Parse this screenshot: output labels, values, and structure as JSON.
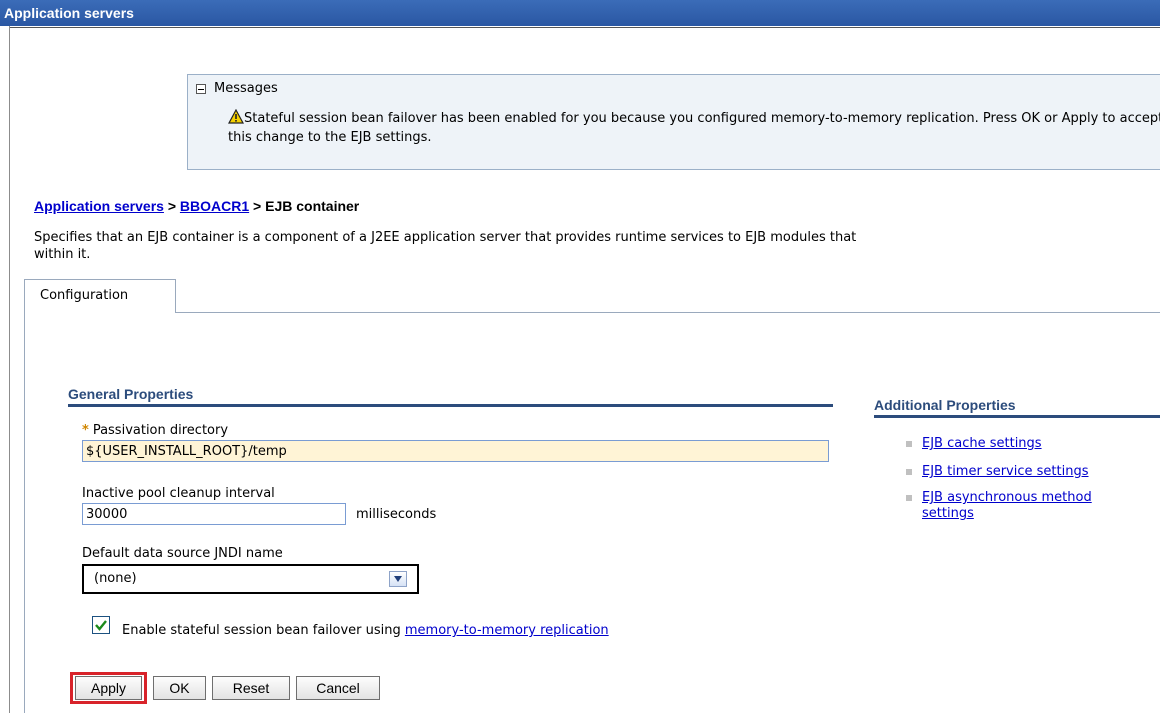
{
  "window": {
    "title": "Application servers"
  },
  "messages": {
    "header": "Messages",
    "text": "Stateful session bean failover has been enabled for you because you configured memory-to-memory replication. Press OK or Apply to accept this change to the EJB settings."
  },
  "breadcrumb": {
    "item1": "Application servers",
    "sep1": ">",
    "item2": "BBOACR1",
    "sep2": ">",
    "current": "EJB container"
  },
  "description": "Specifies that an EJB container is a component of a J2EE application server that provides runtime services to EJB modules that\nwithin it.",
  "tabs": [
    {
      "label": "Configuration",
      "selected": true
    }
  ],
  "general": {
    "title": "General Properties",
    "passivation": {
      "label": "Passivation directory",
      "value": "${USER_INSTALL_ROOT}/temp"
    },
    "cleanup": {
      "label": "Inactive pool cleanup interval",
      "value": "30000",
      "unit": "milliseconds"
    },
    "jndi": {
      "label": "Default data source JNDI name",
      "selected": "(none)"
    },
    "failover": {
      "checked": true,
      "text": "Enable stateful session bean failover using ",
      "link": "memory-to-memory replication"
    }
  },
  "additional": {
    "title": "Additional Properties",
    "items": [
      {
        "label": "EJB cache settings"
      },
      {
        "label": "EJB timer service settings"
      },
      {
        "label": "EJB asynchronous method",
        "label2": "settings"
      }
    ]
  },
  "buttons": {
    "apply": "Apply",
    "ok": "OK",
    "reset": "Reset",
    "cancel": "Cancel"
  },
  "colors": {
    "titlebar": "#2f5fad",
    "link": "#0000cc",
    "section": "#2c4c7c",
    "highlight": "#d8232a"
  }
}
